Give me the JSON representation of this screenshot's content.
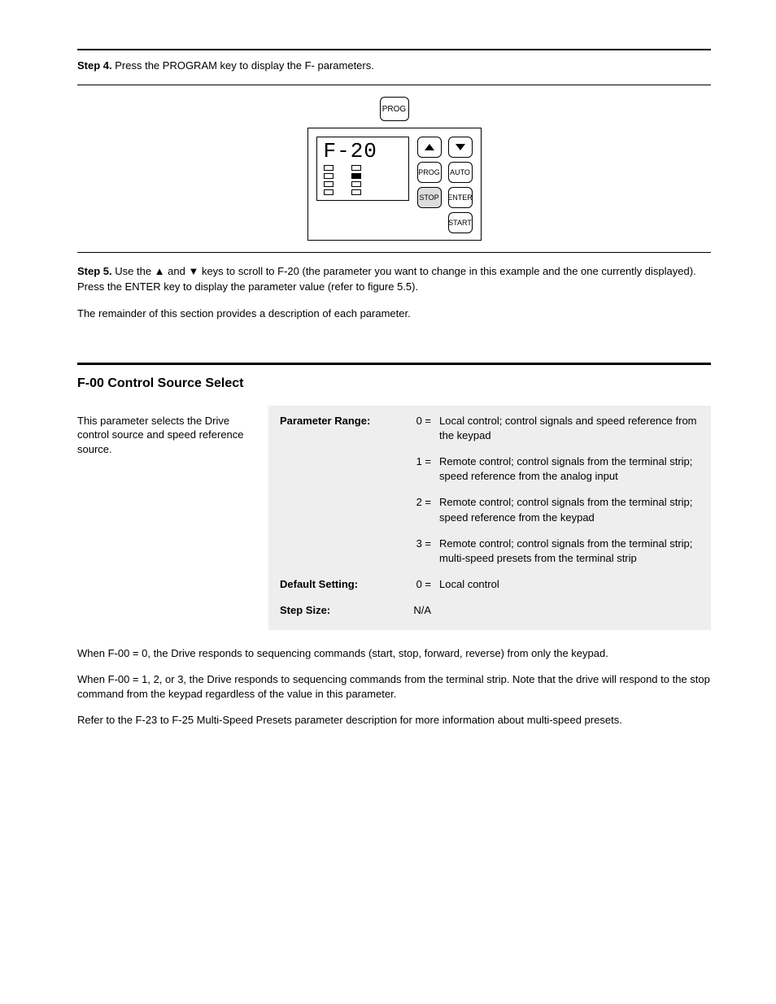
{
  "step4": {
    "label": "Step 4.",
    "text": "Press the PROGRAM key to display the F- parameters."
  },
  "diagram": {
    "top_key": "PROG",
    "lcd_text": "F-20",
    "keys": {
      "prog": "PROG",
      "auto": "AUTO",
      "stop": "STOP",
      "enter": "ENTER",
      "start": "START"
    }
  },
  "step5": {
    "label": "Step 5.",
    "line1a": "Use the ",
    "line1b": " and ",
    "line1c": " keys to scroll to F-20 (the parameter you want to change in this example and the one currently displayed). Press the ",
    "line1d_key": "ENTER",
    "line1e": " key to display the parameter value (refer to ",
    "line1f_ref": "figure 5.5",
    "line1g": ").",
    "line2": "The remainder of this section provides a description of each parameter.",
    "arrow_up_name": "up-arrow-icon",
    "arrow_down_name": "down-arrow-icon"
  },
  "section": {
    "title": "F-00 Control Source Select",
    "desc": "This parameter selects the Drive control source and speed reference source.",
    "labels": {
      "range": "Parameter Range:",
      "default": "Default Setting:",
      "step": "Step Size:"
    },
    "range": [
      {
        "eq": "0  =",
        "text": "Local control; control signals and speed reference from the keypad"
      },
      {
        "eq": "1  =",
        "text": "Remote control; control signals from the terminal strip; speed reference from the analog input"
      },
      {
        "eq": "2  =",
        "text": "Remote control; control signals from the terminal strip; speed reference from the keypad"
      },
      {
        "eq": "3  =",
        "text": "Remote control; control signals from the terminal strip; multi-speed presets from the terminal strip"
      }
    ],
    "default": {
      "eq": "0  =",
      "text": "Local control"
    },
    "step_size": "N/A"
  },
  "body": {
    "p1": "When F-00 = 0, the Drive responds to sequencing commands (start, stop, forward, reverse) from only the keypad.",
    "p2": "When F-00 = 1, 2, or 3, the Drive responds to sequencing commands from the terminal strip. Note that the drive will respond to the stop command from the keypad regardless of the value in this parameter.",
    "p3": "Refer to the F-23 to F-25 Multi-Speed Presets parameter description for more information about multi-speed presets."
  }
}
